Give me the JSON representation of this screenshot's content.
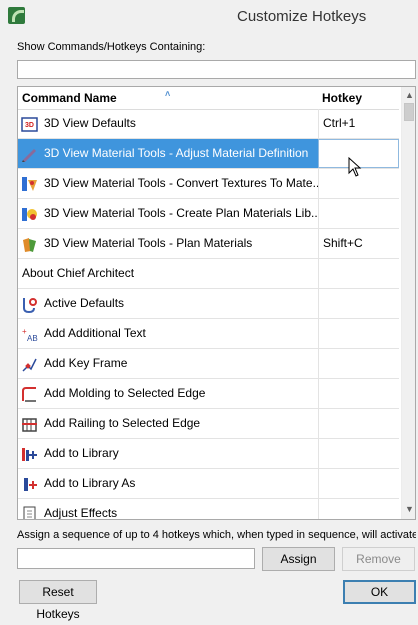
{
  "window": {
    "title": "Customize Hotkeys"
  },
  "search": {
    "label": "Show Commands/Hotkeys Containing:",
    "value": ""
  },
  "table": {
    "columns": {
      "command": "Command Name",
      "hotkey": "Hotkey"
    },
    "sort_indicator": "˄",
    "rows": [
      {
        "command": "3D View Defaults",
        "hotkey": "Ctrl+1",
        "icon": "3d-view-defaults-icon"
      },
      {
        "command": "3D View Material Tools - Adjust Material Definition",
        "hotkey": "",
        "icon": "adjust-material-icon",
        "selected": true
      },
      {
        "command": "3D View Material Tools - Convert Textures To Mate...",
        "hotkey": "",
        "icon": "convert-textures-icon"
      },
      {
        "command": "3D View Material Tools - Create Plan Materials Lib...",
        "hotkey": "",
        "icon": "create-plan-materials-icon"
      },
      {
        "command": "3D View Material Tools - Plan Materials",
        "hotkey": "Shift+C",
        "icon": "plan-materials-icon"
      },
      {
        "command": "About Chief Architect",
        "hotkey": "",
        "icon": ""
      },
      {
        "command": "Active Defaults",
        "hotkey": "",
        "icon": "active-defaults-icon"
      },
      {
        "command": "Add Additional Text",
        "hotkey": "",
        "icon": "add-text-icon"
      },
      {
        "command": "Add Key Frame",
        "hotkey": "",
        "icon": "key-frame-icon"
      },
      {
        "command": "Add Molding to Selected Edge",
        "hotkey": "",
        "icon": "molding-icon"
      },
      {
        "command": "Add Railing to Selected Edge",
        "hotkey": "",
        "icon": "railing-icon"
      },
      {
        "command": "Add to Library",
        "hotkey": "",
        "icon": "add-library-icon"
      },
      {
        "command": "Add to Library As",
        "hotkey": "",
        "icon": "add-library-as-icon"
      },
      {
        "command": "Adjust Effects",
        "hotkey": "",
        "icon": "adjust-effects-icon"
      }
    ]
  },
  "instructions": "Assign a sequence of up to 4 hotkeys which, when typed in sequence, will activate t",
  "hotkey_input": {
    "value": ""
  },
  "buttons": {
    "assign": "Assign",
    "remove": "Remove",
    "reset": "Reset Hotkeys",
    "ok": "OK"
  }
}
